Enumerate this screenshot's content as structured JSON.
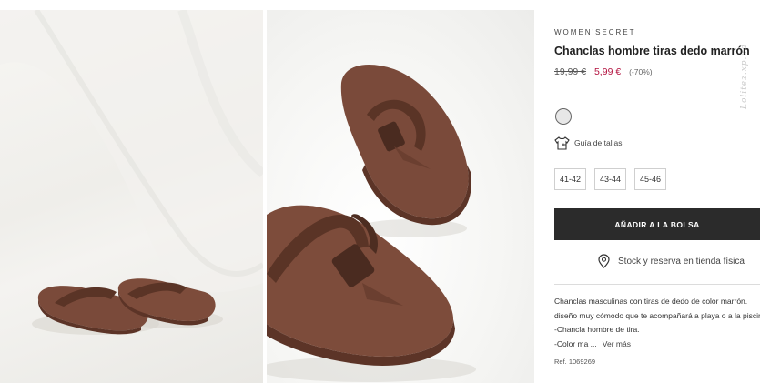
{
  "gallery": {
    "images": [
      {
        "subject": "pair of brown flip-flops on white backdrop"
      },
      {
        "subject": "close-up of brown flip-flops with woven straps"
      }
    ]
  },
  "product": {
    "brand": "WOMEN'SECRET",
    "title": "Chanclas hombre tiras dedo marrón",
    "old_price": "19,99 €",
    "new_price": "5,99 €",
    "discount": "(-70%)",
    "watermark": "Lolitez.xp.ua",
    "swatch_color": "#e7e7e7",
    "size_guide_label": "Guía de tallas",
    "sizes": [
      "41-42",
      "43-44",
      "45-46"
    ],
    "add_button_label": "AÑADIR A LA BOLSA",
    "stock_label": "Stock y reserva en tienda física",
    "description": {
      "line1": "Chanclas masculinas con tiras de dedo de color marrón.",
      "line2": "diseño muy cómodo que te acompañará a playa o a la piscina",
      "line3": "-Chancla hombre de tira.",
      "line4": "-Color ma ...",
      "more_link": "Ver más"
    },
    "reference": "Ref. 1069269"
  },
  "colors": {
    "price_sale": "#b3123f",
    "button_bg": "#2b2b2b",
    "sandal_brown": "#7a4a3a"
  }
}
